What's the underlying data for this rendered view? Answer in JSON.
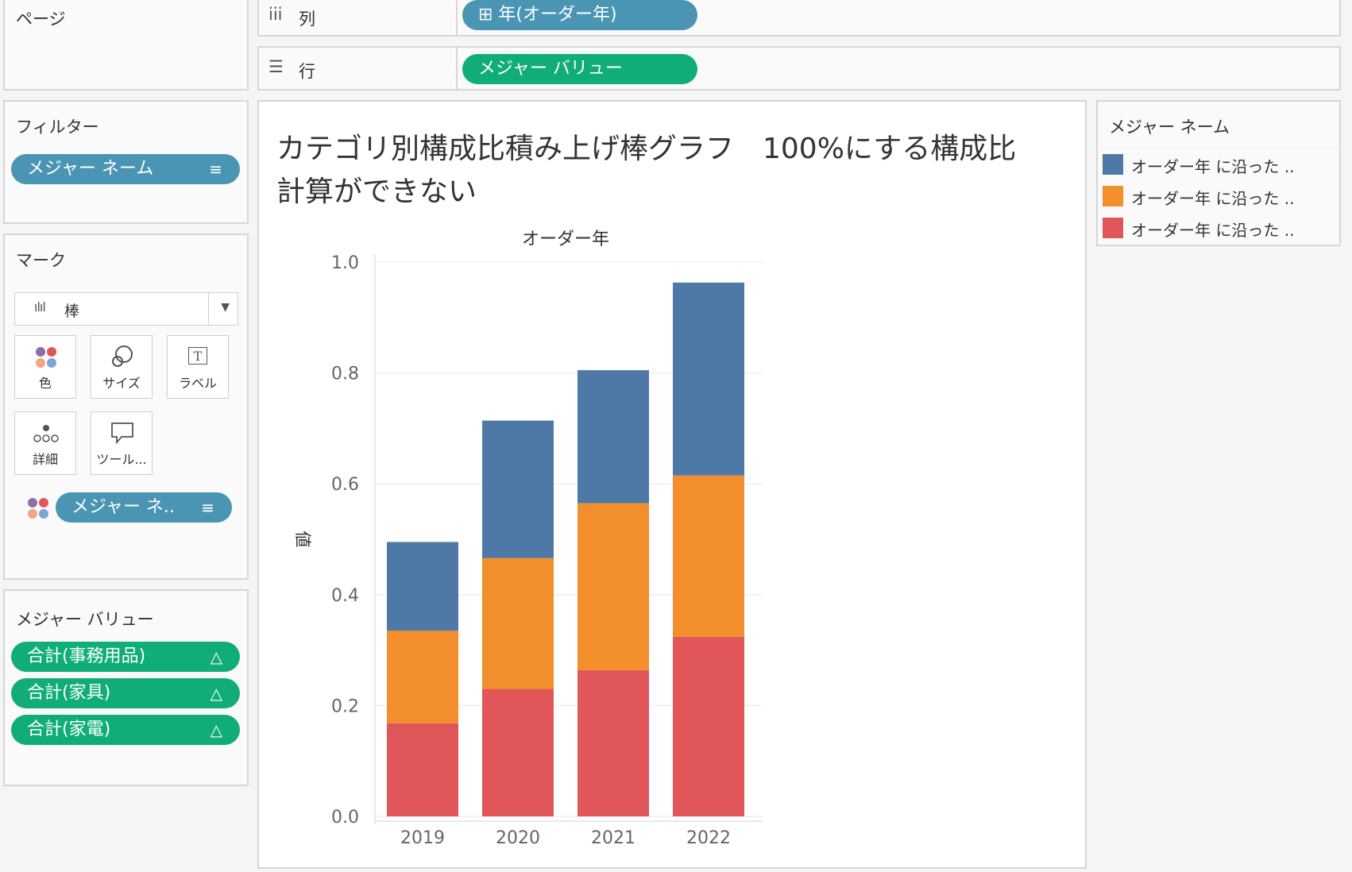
{
  "pages_card": {
    "title": "ページ"
  },
  "shelves": {
    "columns": {
      "icon": "iii",
      "label": "列",
      "pill": "⊞ 年(オーダー年)"
    },
    "rows": {
      "icon": "☰",
      "label": "行",
      "pill": "メジャー バリュー"
    }
  },
  "filters": {
    "title": "フィルター",
    "pill": "メジャー ネーム",
    "pill_icon": "≡"
  },
  "marks": {
    "title": "マーク",
    "mark_type": "棒",
    "mark_type_icon": "ılıl",
    "dropdown_arrow": "▼",
    "buttons": [
      {
        "label": "色",
        "icon": "●●"
      },
      {
        "label": "サイズ",
        "icon": "◌"
      },
      {
        "label": "ラベル",
        "icon": "T"
      },
      {
        "label": "詳細",
        "icon": "∘∘∘"
      },
      {
        "label": "ツール...",
        "icon": "▭"
      }
    ],
    "pill": "メジャー ネ..",
    "pill_icon": "≡"
  },
  "measure_values": {
    "title": "メジャー バリュー",
    "items": [
      {
        "label": "合計(事務用品)",
        "icon": "△"
      },
      {
        "label": "合計(家具)",
        "icon": "△"
      },
      {
        "label": "合計(家電)",
        "icon": "△"
      }
    ]
  },
  "legend": {
    "title": "メジャー ネーム",
    "items": [
      {
        "label": "オーダー年 に沿った ..",
        "color": "#4e79a7"
      },
      {
        "label": "オーダー年 に沿った ..",
        "color": "#f28e2b"
      },
      {
        "label": "オーダー年 に沿った ..",
        "color": "#e15759"
      }
    ]
  },
  "chart_data": {
    "type": "bar",
    "stacked": true,
    "title": "カテゴリ別構成比積み上げ棒グラフ　100%にする構成比計算ができない",
    "title_line1": "カテゴリ別構成比積み上げ棒グラフ　100%にする構成比",
    "title_line2": "計算ができない",
    "column_header": "オーダー年",
    "ylabel": "値",
    "xlabel": "",
    "categories": [
      "2019",
      "2020",
      "2021",
      "2022"
    ],
    "ylim": [
      0,
      1.0
    ],
    "yticks": [
      "0.0",
      "0.2",
      "0.4",
      "0.6",
      "0.8",
      "1.0"
    ],
    "grid": true,
    "series": [
      {
        "name": "",
        "color": "#e15759",
        "values": [
          0.168,
          0.23,
          0.264,
          0.324
        ]
      },
      {
        "name": "",
        "color": "#f28e2b",
        "values": [
          0.167,
          0.236,
          0.301,
          0.291
        ]
      },
      {
        "name": "",
        "color": "#4e79a7",
        "values": [
          0.16,
          0.248,
          0.24,
          0.348
        ]
      }
    ]
  }
}
